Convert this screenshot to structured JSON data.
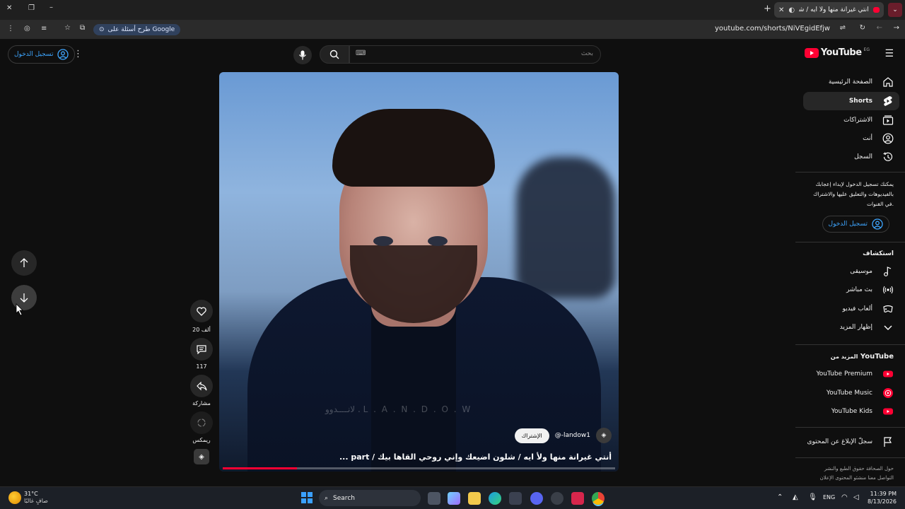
{
  "browser": {
    "tab_title": "أنتي غيرانة منها ولأ ايه / شلو",
    "url": "youtube.com/shorts/NiVEgidEfjw",
    "google_button": "طرح أسئلة على Google"
  },
  "masthead": {
    "logo_text": "YouTube",
    "logo_country": "EG",
    "search_placeholder": "بحث",
    "signin_label": "تسجيل الدخول"
  },
  "sidebar": {
    "items": [
      {
        "label": "الصفحة الرئيسية",
        "icon": "home-icon"
      },
      {
        "label": "Shorts",
        "icon": "shorts-icon",
        "active": true
      },
      {
        "label": "الاشتراكات",
        "icon": "subscriptions-icon"
      },
      {
        "label": "أنت",
        "icon": "account-icon"
      },
      {
        "label": "السجل",
        "icon": "history-icon"
      }
    ],
    "signin_prompt": [
      "يمكنك تسجيل الدخول لإبداء إعجابك",
      "بالفيديوهات والتعليق عليها والاشتراك",
      "في القنوات."
    ],
    "signin_label": "تسجيل الدخول",
    "explore_heading": "استكشاف",
    "explore": [
      {
        "label": "موسيقى",
        "icon": "music-icon"
      },
      {
        "label": "بث مباشر",
        "icon": "live-icon"
      },
      {
        "label": "ألعاب فيديو",
        "icon": "gaming-icon"
      },
      {
        "label": "إظهار المزيد",
        "icon": "chevron-down-icon"
      }
    ],
    "more_heading_prefix": "المزيد من",
    "more_heading_brand": "YouTube",
    "more": [
      {
        "label": "YouTube Premium",
        "icon": "youtube-premium-icon"
      },
      {
        "label": "YouTube Music",
        "icon": "youtube-music-icon"
      },
      {
        "label": "YouTube Kids",
        "icon": "youtube-kids-icon"
      }
    ],
    "report_label": "سجلّ الإبلاغ عن المحتوى",
    "footer": [
      "حول  الصحافة  حقوق الطبع والنشر",
      "التواصل معنا  منشئو المحتوى  الإعلان"
    ]
  },
  "short": {
    "channel": "@-landow1",
    "subscribe_label": "الإشتراك",
    "caption": "أنتي غيرانة منها ولأ ايه / شلون اضيعك وإني روحي القاها بيك / part ...",
    "watermark": "لانــــدوو . L . A . N . D . O . W",
    "progress": 0.19
  },
  "actions": {
    "likes": "20 ألف",
    "comments": "117",
    "share": "مشاركة",
    "remix": "ريمكس"
  },
  "taskbar": {
    "weather_temp": "31°C",
    "weather_desc": "صافٍ غالبًا",
    "search_label": "Search",
    "lang": "ENG",
    "time": "11:39 PM",
    "date": "8/13/2026"
  }
}
